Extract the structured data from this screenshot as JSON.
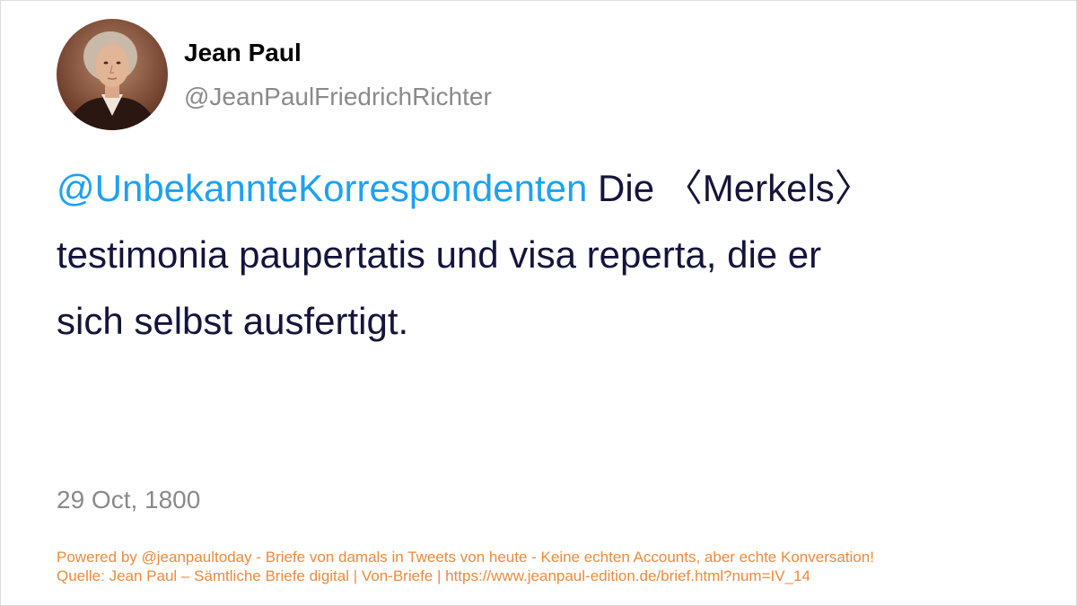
{
  "author": {
    "display_name": "Jean Paul",
    "handle": "@JeanPaulFriedrichRichter",
    "avatar_icon": "portrait-avatar"
  },
  "tweet": {
    "mention": "@UnbekannteKorrespondenten",
    "text_line1": " Die 〈Merkels〉",
    "text_line2": "testimonia paupertatis und visa reperta, die er",
    "text_line3": "sich selbst ausfertigt.",
    "date": "29 Oct, 1800"
  },
  "footer": {
    "line1": "Powered by @jeanpaultoday - Briefe von damals in Tweets von heute - Keine echten Accounts, aber echte Konversation!",
    "line2": "Quelle: Jean Paul – Sämtliche Briefe digital | Von-Briefe | https://www.jeanpaul-edition.de/brief.html?num=IV_14"
  },
  "colors": {
    "mention": "#1da1f2",
    "body_text": "#14143c",
    "muted": "#8a8a8a",
    "footer": "#f08a3c"
  }
}
